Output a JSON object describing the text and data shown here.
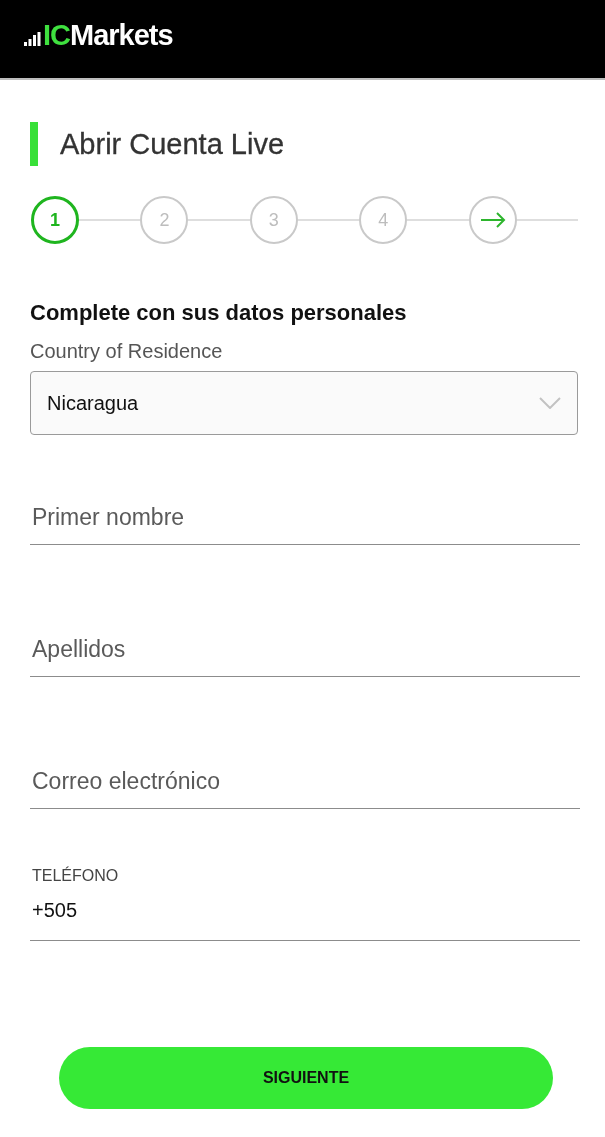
{
  "header": {
    "logo_mark": "IC",
    "logo_text": "Markets"
  },
  "title": "Abrir Cuenta Live",
  "steps": [
    {
      "kind": "number",
      "label": "1",
      "selected": true
    },
    {
      "kind": "number",
      "label": "2",
      "selected": false
    },
    {
      "kind": "number",
      "label": "3",
      "selected": false
    },
    {
      "kind": "number",
      "label": "4",
      "selected": false
    },
    {
      "kind": "arrow",
      "selected": false
    }
  ],
  "section_heading": "Complete con sus datos personales",
  "country": {
    "label": "Country of Residence",
    "value": "Nicaragua"
  },
  "fields": [
    {
      "kind": "placeholder",
      "placeholder": "Primer nombre"
    },
    {
      "kind": "placeholder",
      "placeholder": "Apellidos"
    },
    {
      "kind": "placeholder",
      "placeholder": "Correo electrónico"
    },
    {
      "kind": "labeled",
      "label": "TELÉFONO",
      "value": "+505"
    }
  ],
  "submit": {
    "label": "SIGUIENTE"
  }
}
